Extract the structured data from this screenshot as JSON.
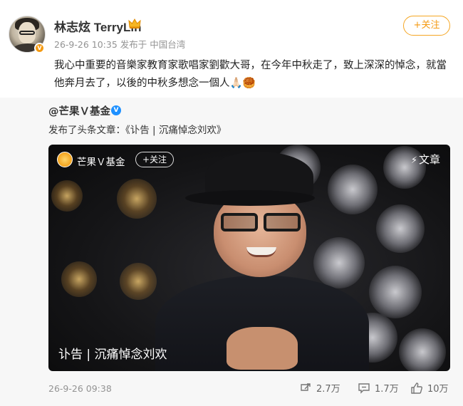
{
  "post": {
    "username": "林志炫 TerryLin",
    "meta": "26-9-26 10:35  发布于 中国台湾",
    "follow_label": "+关注",
    "text": "我心中重要的音樂家教育家歌唱家劉歡大哥，在今年中秋走了，致上深深的悼念，就當他奔月去了，以後的中秋多想念一個人🙏🏻🥮"
  },
  "repost": {
    "author": "@芒果Ｖ基金",
    "description": "发布了头条文章：《讣告 | 沉痛悼念刘欢》",
    "card": {
      "account_name": "芒果Ｖ基金",
      "follow_label": "+关注",
      "type_label": "文章",
      "title": "讣告 | 沉痛悼念刘欢"
    },
    "time": "26-9-26 09:38",
    "stats": {
      "reposts": "2.7万",
      "comments": "1.7万",
      "likes": "10万"
    }
  },
  "colors": {
    "accent_orange": "#f49a12",
    "verify_blue": "#1e90ff",
    "meta_gray": "#939393"
  },
  "icons": [
    "verified-orange-icon",
    "crown-icon",
    "verified-blue-icon",
    "lightning-icon",
    "repost-icon",
    "comment-icon",
    "like-icon"
  ]
}
